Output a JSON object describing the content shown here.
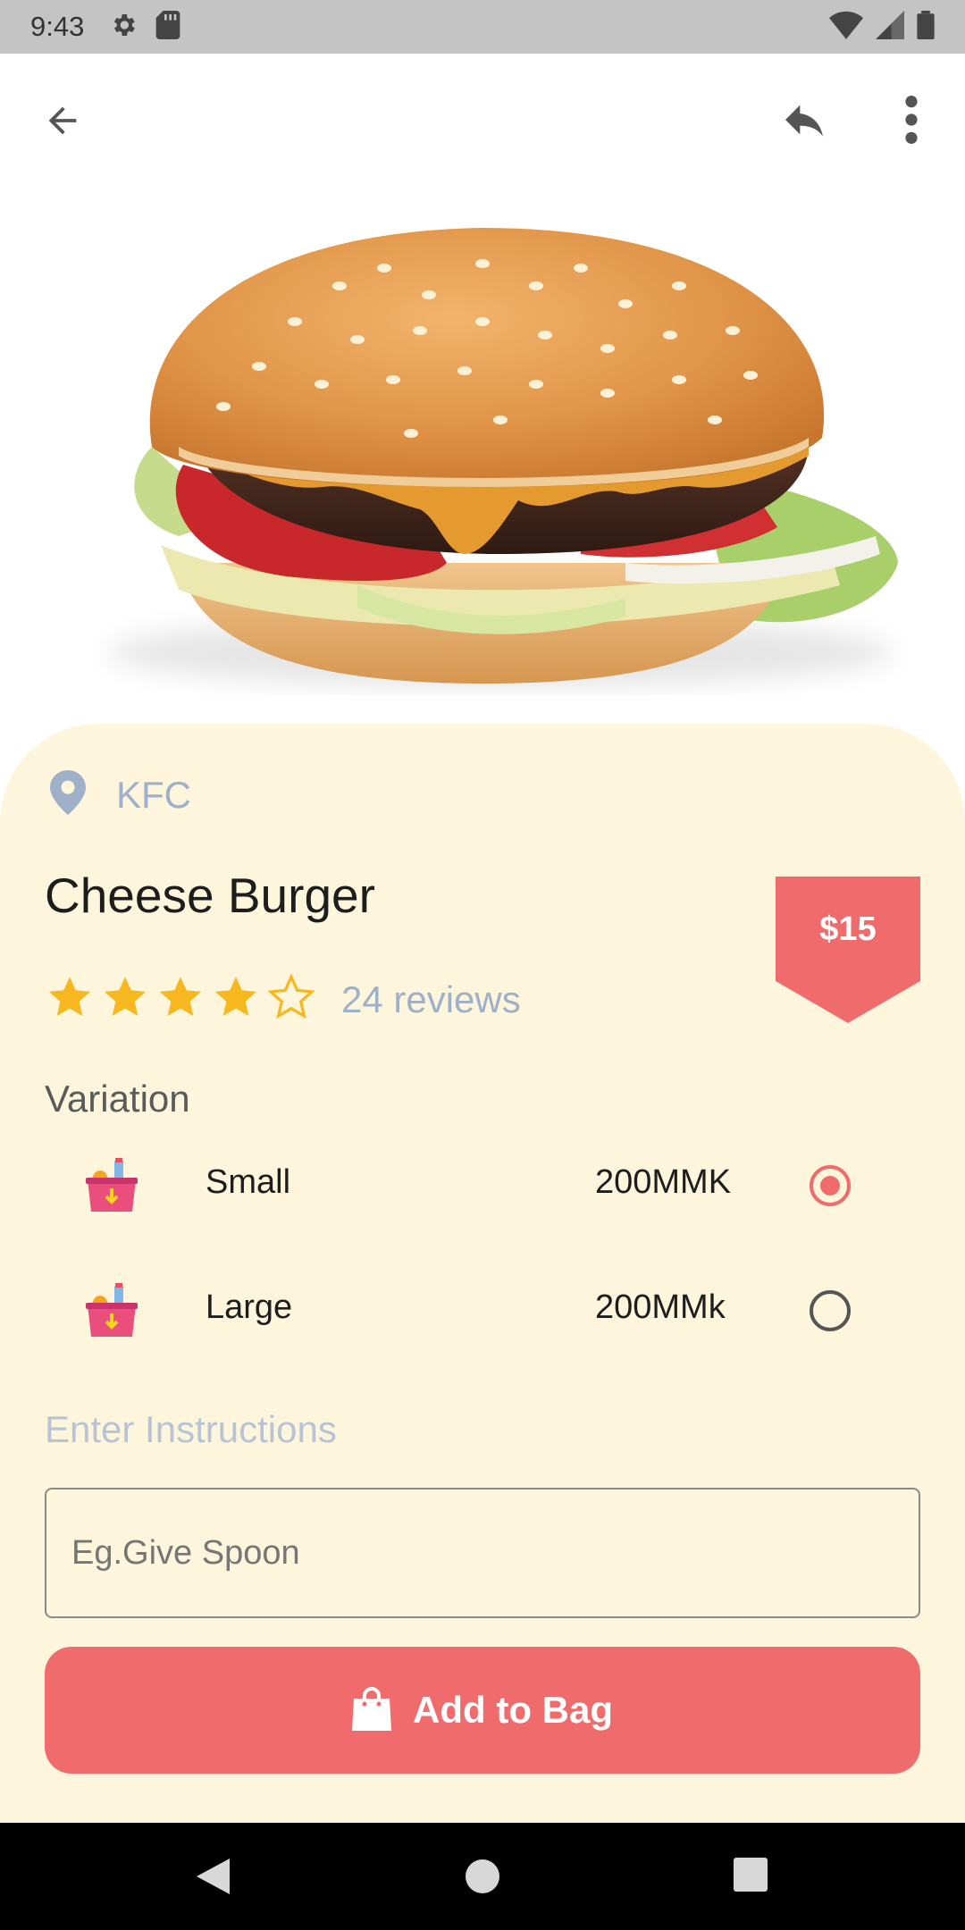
{
  "status_bar": {
    "time": "9:43",
    "icons_left": [
      "gear-icon",
      "sd-card-icon"
    ],
    "icons_right": [
      "wifi-icon",
      "cell-signal-icon",
      "battery-icon"
    ]
  },
  "app_bar": {
    "back_icon": "arrow-back-icon",
    "share_icon": "reply-share-icon",
    "more_icon": "more-vert-icon"
  },
  "hero": {
    "image": "cheeseburger-photo"
  },
  "product": {
    "store": "KFC",
    "name": "Cheese Burger",
    "price": "$15",
    "rating": 4,
    "rating_max": 5,
    "reviews": "24 reviews"
  },
  "variation": {
    "title": "Variation",
    "options": [
      {
        "label": "Small",
        "price": "200MMK",
        "selected": true
      },
      {
        "label": "Large",
        "price": "200MMk",
        "selected": false
      }
    ]
  },
  "instructions": {
    "label": "Enter Instructions",
    "placeholder": "Eg.Give Spoon",
    "value": ""
  },
  "cta": {
    "label": "Add to Bag",
    "icon": "shopping-bag-icon"
  },
  "colors": {
    "accent": "#ef6b6c",
    "sheet": "#fdf6dd",
    "muted": "#9fb1c8",
    "star": "#f7b81f"
  },
  "nav_bar": {
    "icons": [
      "nav-back-icon",
      "nav-home-icon",
      "nav-recent-icon"
    ]
  }
}
